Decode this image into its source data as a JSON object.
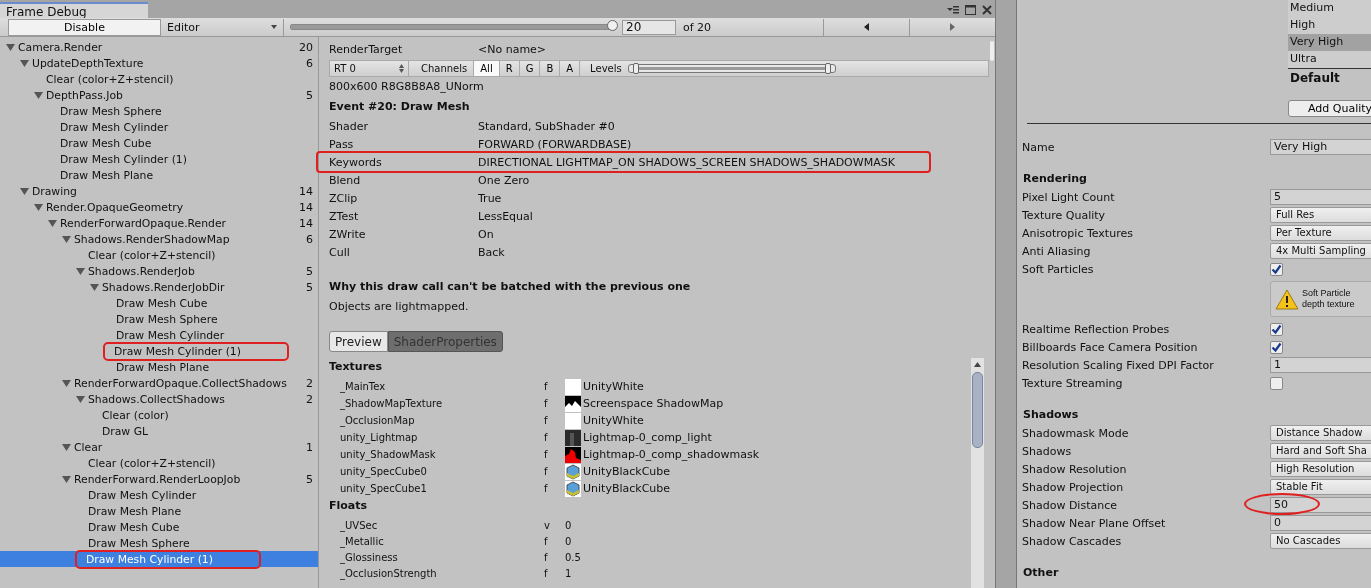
{
  "window": {
    "title": "Frame Debug"
  },
  "toolbar": {
    "disable_button": "Disable",
    "mode_dropdown": "Editor",
    "event_slider": {
      "level": 1
    },
    "event_field": "20",
    "event_total": "of 20"
  },
  "tree": [
    {
      "label": "Camera.Render",
      "count": "20",
      "expanded": true,
      "selected": false,
      "marked": false,
      "children": [
        {
          "label": "UpdateDepthTexture",
          "count": "6",
          "expanded": true,
          "selected": false,
          "marked": false,
          "children": [
            {
              "label": "Clear (color+Z+stencil)",
              "selected": false,
              "marked": false
            },
            {
              "label": "DepthPass.Job",
              "count": "5",
              "expanded": true,
              "selected": false,
              "marked": false,
              "children": [
                {
                  "label": "Draw Mesh Sphere",
                  "selected": false,
                  "marked": false
                },
                {
                  "label": "Draw Mesh Cylinder",
                  "selected": false,
                  "marked": false
                },
                {
                  "label": "Draw Mesh Cube",
                  "selected": false,
                  "marked": false
                },
                {
                  "label": "Draw Mesh Cylinder (1)",
                  "selected": false,
                  "marked": false
                },
                {
                  "label": "Draw Mesh Plane",
                  "selected": false,
                  "marked": false
                }
              ]
            }
          ]
        },
        {
          "label": "Drawing",
          "count": "14",
          "expanded": true,
          "selected": false,
          "marked": false,
          "children": [
            {
              "label": "Render.OpaqueGeometry",
              "count": "14",
              "expanded": true,
              "selected": false,
              "marked": false,
              "children": [
                {
                  "label": "RenderForwardOpaque.Render",
                  "count": "14",
                  "expanded": true,
                  "selected": false,
                  "marked": false,
                  "children": [
                    {
                      "label": "Shadows.RenderShadowMap",
                      "count": "6",
                      "expanded": true,
                      "selected": false,
                      "marked": false,
                      "children": [
                        {
                          "label": "Clear (color+Z+stencil)",
                          "selected": false,
                          "marked": false
                        },
                        {
                          "label": "Shadows.RenderJob",
                          "count": "5",
                          "expanded": true,
                          "selected": false,
                          "marked": false,
                          "children": [
                            {
                              "label": "Shadows.RenderJobDir",
                              "count": "5",
                              "expanded": true,
                              "selected": false,
                              "marked": false,
                              "children": [
                                {
                                  "label": "Draw Mesh Cube",
                                  "selected": false,
                                  "marked": false
                                },
                                {
                                  "label": "Draw Mesh Sphere",
                                  "selected": false,
                                  "marked": false
                                },
                                {
                                  "label": "Draw Mesh Cylinder",
                                  "selected": false,
                                  "marked": false
                                },
                                {
                                  "label": "Draw Mesh Cylinder (1)",
                                  "selected": false,
                                  "marked": true
                                },
                                {
                                  "label": "Draw Mesh Plane",
                                  "selected": false,
                                  "marked": false
                                }
                              ]
                            }
                          ]
                        }
                      ]
                    },
                    {
                      "label": "RenderForwardOpaque.CollectShadows",
                      "count": "2",
                      "expanded": true,
                      "selected": false,
                      "marked": false,
                      "children": [
                        {
                          "label": "Shadows.CollectShadows",
                          "count": "2",
                          "expanded": true,
                          "selected": false,
                          "marked": false,
                          "children": [
                            {
                              "label": "Clear (color)",
                              "selected": false,
                              "marked": false
                            },
                            {
                              "label": "Draw GL",
                              "selected": false,
                              "marked": false
                            }
                          ]
                        }
                      ]
                    },
                    {
                      "label": "Clear",
                      "count": "1",
                      "expanded": true,
                      "selected": false,
                      "marked": false,
                      "children": [
                        {
                          "label": "Clear (color+Z+stencil)",
                          "selected": false,
                          "marked": false
                        }
                      ]
                    },
                    {
                      "label": "RenderForward.RenderLoopJob",
                      "count": "5",
                      "expanded": true,
                      "selected": false,
                      "marked": false,
                      "children": [
                        {
                          "label": "Draw Mesh Cylinder",
                          "selected": false,
                          "marked": false
                        },
                        {
                          "label": "Draw Mesh Plane",
                          "selected": false,
                          "marked": false
                        },
                        {
                          "label": "Draw Mesh Cube",
                          "selected": false,
                          "marked": false
                        },
                        {
                          "label": "Draw Mesh Sphere",
                          "selected": false,
                          "marked": false
                        },
                        {
                          "label": "Draw Mesh Cylinder (1)",
                          "selected": true,
                          "marked": true
                        }
                      ]
                    }
                  ]
                }
              ]
            }
          ]
        }
      ]
    }
  ],
  "render_target": {
    "label": "RenderTarget",
    "value": "<No name>"
  },
  "rt_toolbar": {
    "rt_dropdown": "RT 0",
    "channels_label": "Channels",
    "channels": [
      {
        "label": "All",
        "selected": true
      },
      {
        "label": "R",
        "selected": false
      },
      {
        "label": "G",
        "selected": false
      },
      {
        "label": "B",
        "selected": false
      },
      {
        "label": "A",
        "selected": false
      }
    ],
    "levels_label": "Levels",
    "levels_slider": {
      "level": 1
    }
  },
  "format": "800x600 R8G8B8A8_UNorm",
  "event_title": "Event #20: Draw Mesh",
  "properties": [
    {
      "name": "Shader",
      "value": "Standard, SubShader #0",
      "marked": false
    },
    {
      "name": "Pass",
      "value": "FORWARD (FORWARDBASE)",
      "marked": false
    },
    {
      "name": "Keywords",
      "value": "DIRECTIONAL LIGHTMAP_ON SHADOWS_SCREEN SHADOWS_SHADOWMASK",
      "marked": true
    },
    {
      "name": "Blend",
      "value": "One Zero",
      "marked": false
    },
    {
      "name": "ZClip",
      "value": "True",
      "marked": false
    },
    {
      "name": "ZTest",
      "value": "LessEqual",
      "marked": false
    },
    {
      "name": "ZWrite",
      "value": "On",
      "marked": false
    },
    {
      "name": "Cull",
      "value": "Back",
      "marked": false
    }
  ],
  "batch_heading": "Why this draw call can't be batched with the previous one",
  "batch_reason": "Objects are lightmapped.",
  "view_tabs": [
    {
      "label": "Preview",
      "selected": false
    },
    {
      "label": "ShaderProperties",
      "selected": true
    }
  ],
  "textures": {
    "heading": "Textures",
    "rows": [
      {
        "name": "_MainTex",
        "type": "f",
        "kind": "white",
        "value": "UnityWhite"
      },
      {
        "name": "_ShadowMapTexture",
        "type": "f",
        "kind": "shadowmap",
        "value": "Screenspace ShadowMap"
      },
      {
        "name": "_OcclusionMap",
        "type": "f",
        "kind": "white",
        "value": "UnityWhite"
      },
      {
        "name": "unity_Lightmap",
        "type": "f",
        "kind": "lightmap",
        "value": "Lightmap-0_comp_light"
      },
      {
        "name": "unity_ShadowMask",
        "type": "f",
        "kind": "shadowmask",
        "value": "Lightmap-0_comp_shadowmask"
      },
      {
        "name": "unity_SpecCube0",
        "type": "f",
        "kind": "cube",
        "value": "UnityBlackCube"
      },
      {
        "name": "unity_SpecCube1",
        "type": "f",
        "kind": "cube",
        "value": "UnityBlackCube"
      }
    ]
  },
  "floats": {
    "heading": "Floats",
    "rows": [
      {
        "name": "_UVSec",
        "type": "v",
        "value": "0"
      },
      {
        "name": "_Metallic",
        "type": "f",
        "value": "0"
      },
      {
        "name": "_Glossiness",
        "type": "f",
        "value": "0.5"
      },
      {
        "name": "_OcclusionStrength",
        "type": "f",
        "value": "1"
      }
    ]
  },
  "quality_levels": [
    {
      "name": "Medium",
      "selected": false
    },
    {
      "name": "High",
      "selected": false
    },
    {
      "name": "Very High",
      "selected": true
    },
    {
      "name": "Ultra",
      "selected": false
    }
  ],
  "default_label": "Default",
  "add_button": "Add Quality",
  "name_field": {
    "label": "Name",
    "value": "Very High"
  },
  "sections": [
    {
      "heading": "Rendering",
      "rows": [
        {
          "kind": "field",
          "label": "Pixel Light Count",
          "value": "5",
          "marked": false
        },
        {
          "kind": "dropdown",
          "label": "Texture Quality",
          "value": "Full Res"
        },
        {
          "kind": "dropdown",
          "label": "Anisotropic Textures",
          "value": "Per Texture"
        },
        {
          "kind": "dropdown",
          "label": "Anti Aliasing",
          "value": "4x Multi Sampling"
        },
        {
          "kind": "checkbox",
          "label": "Soft Particles",
          "checked": true
        },
        {
          "kind": "warning",
          "lines": [
            "Soft Particle",
            "depth texture"
          ]
        },
        {
          "kind": "checkbox",
          "label": "Realtime Reflection Probes",
          "checked": true
        },
        {
          "kind": "checkbox",
          "label": "Billboards Face Camera Position",
          "checked": true
        },
        {
          "kind": "field",
          "label": "Resolution Scaling Fixed DPI Factor",
          "value": "1",
          "marked": false
        },
        {
          "kind": "checkbox",
          "label": "Texture Streaming",
          "checked": false
        }
      ]
    },
    {
      "heading": "Shadows",
      "rows": [
        {
          "kind": "dropdown",
          "label": "Shadowmask Mode",
          "value": "Distance Shadow"
        },
        {
          "kind": "dropdown",
          "label": "Shadows",
          "value": "Hard and Soft Sha"
        },
        {
          "kind": "dropdown",
          "label": "Shadow Resolution",
          "value": "High Resolution"
        },
        {
          "kind": "dropdown",
          "label": "Shadow Projection",
          "value": "Stable Fit"
        },
        {
          "kind": "field",
          "label": "Shadow Distance",
          "value": "50",
          "marked": true
        },
        {
          "kind": "field",
          "label": "Shadow Near Plane Offset",
          "value": "0",
          "marked": false
        },
        {
          "kind": "dropdown",
          "label": "Shadow Cascades",
          "value": "No Cascades"
        }
      ]
    },
    {
      "heading": "Other"
    }
  ]
}
